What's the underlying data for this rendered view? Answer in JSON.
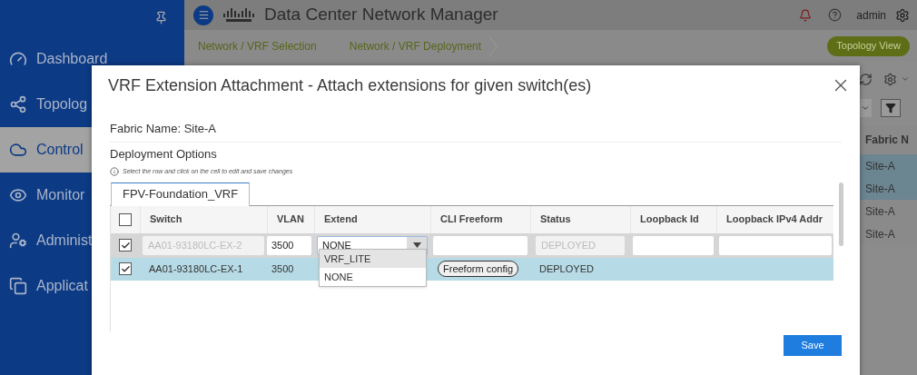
{
  "sidebar": {
    "items": [
      {
        "kind": "dashboard",
        "label": "Dashboard",
        "selected": false
      },
      {
        "kind": "topology",
        "label": "Topolog",
        "selected": false
      },
      {
        "kind": "control",
        "label": "Control",
        "selected": true
      },
      {
        "kind": "monitor",
        "label": "Monitor",
        "selected": false
      },
      {
        "kind": "admin",
        "label": "Administ",
        "selected": false
      },
      {
        "kind": "apps",
        "label": "Applicat",
        "selected": false
      }
    ]
  },
  "header": {
    "title": "Data Center Network Manager",
    "user": "admin"
  },
  "breadcrumbs": [
    "Network / VRF Selection",
    "Network / VRF Deployment"
  ],
  "topology_button": "Topology View",
  "background_table": {
    "column_1": "Fabric N",
    "rows": [
      {
        "cell": "Site-A",
        "selected": true
      },
      {
        "cell": "Site-A",
        "selected": true
      },
      {
        "cell": "Site-A",
        "selected": false
      },
      {
        "cell": "Site-A",
        "selected": false
      }
    ]
  },
  "dialog": {
    "title": "VRF Extension Attachment - Attach extensions for given switch(es)",
    "fabric_name": "Fabric Name: Site-A",
    "section": "Deployment Options",
    "hint": "Select the row and click on the cell to edit and save changes",
    "tabs": [
      {
        "label": "FPV-Foundation_VRF",
        "selected": true
      }
    ],
    "header_checked": false,
    "columns": [
      "Switch",
      "VLAN",
      "Extend",
      "CLI Freeform",
      "Status",
      "Loopback Id",
      "Loopback IPv4 Addr"
    ],
    "edit_row": {
      "checked": true,
      "switch": "AA01-93180LC-EX-2",
      "vlan": "3500",
      "extend": "NONE",
      "status": "DEPLOYED"
    },
    "rows": [
      {
        "checked": true,
        "selected": true,
        "switch": "AA01-93180LC-EX-1",
        "vlan": "3500",
        "freeform": "Freeform config",
        "status": "DEPLOYED"
      }
    ],
    "dropdown": [
      {
        "label": "VRF_LITE",
        "highlighted": true
      },
      {
        "label": "NONE",
        "highlighted": false
      }
    ],
    "save": "Save"
  }
}
